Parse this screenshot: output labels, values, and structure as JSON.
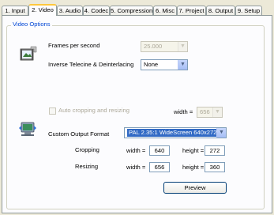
{
  "tabs": [
    {
      "label": "1. Input",
      "active": false
    },
    {
      "label": "2. Video",
      "active": true
    },
    {
      "label": "3. Audio",
      "active": false
    },
    {
      "label": "4. Codec",
      "active": false
    },
    {
      "label": "5. Compression",
      "active": false
    },
    {
      "label": "6. Misc",
      "active": false
    },
    {
      "label": "7. Project",
      "active": false
    },
    {
      "label": "8. Output",
      "active": false
    },
    {
      "label": "9. Setup",
      "active": false
    }
  ],
  "group": {
    "title": "Video Options"
  },
  "fps": {
    "label": "Frames per second",
    "value": "25.000"
  },
  "ivtc": {
    "label": "Inverse Telecine & Deinterlacing",
    "value": "None"
  },
  "auto_crop": {
    "label": "Auto cropping and resizing",
    "width_label": "width =",
    "width_value": "656",
    "checked": false,
    "enabled": false
  },
  "output_format": {
    "label": "Custom Output Format",
    "value": "PAL 2.35:1 WideScreen  640x272"
  },
  "cropping": {
    "label": "Cropping",
    "width_label": "width =",
    "width_value": "640",
    "height_label": "height =",
    "height_value": "272"
  },
  "resizing": {
    "label": "Resizing",
    "width_label": "width =",
    "width_value": "656",
    "height_label": "height =",
    "height_value": "360"
  },
  "preview_button": {
    "label": "Preview"
  },
  "icons": {
    "film": "film-icon",
    "monitor": "monitor-icon"
  },
  "colors": {
    "tab_highlight": "#ffc83c",
    "group_title": "#0046d5",
    "selection": "#316ac5"
  }
}
